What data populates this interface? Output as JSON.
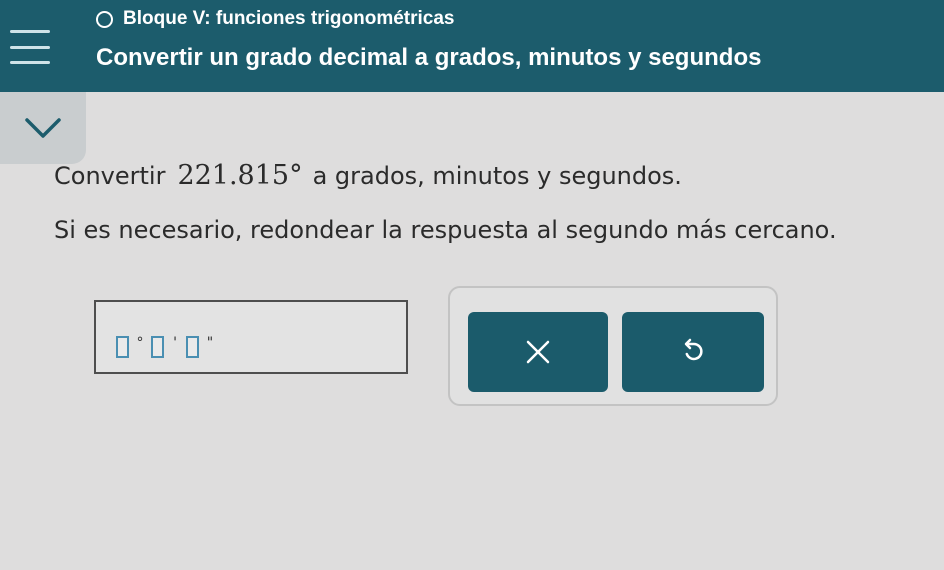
{
  "header": {
    "topic": "Bloque V: funciones trigonométricas",
    "title": "Convertir un grado decimal a grados, minutos y segundos"
  },
  "problem": {
    "prefix": "Convertir",
    "value": "221.815°",
    "suffix": "a grados, minutos y segundos.",
    "instruction": "Si es necesario, redondear la respuesta al segundo más cercano."
  },
  "answer": {
    "degree_symbol": "°",
    "minute_symbol": "'",
    "second_symbol": "\"",
    "degrees_value": "",
    "minutes_value": "",
    "seconds_value": ""
  },
  "icons": {
    "menu": "menu-icon",
    "topic_status": "circle-icon",
    "collapse": "chevron-down-icon",
    "clear": "close-icon",
    "undo": "undo-icon"
  },
  "colors": {
    "header_bg": "#1c5c6c",
    "button_bg": "#1b5b6b",
    "input_border": "#4a8fb2",
    "page_bg": "#dedddd"
  }
}
